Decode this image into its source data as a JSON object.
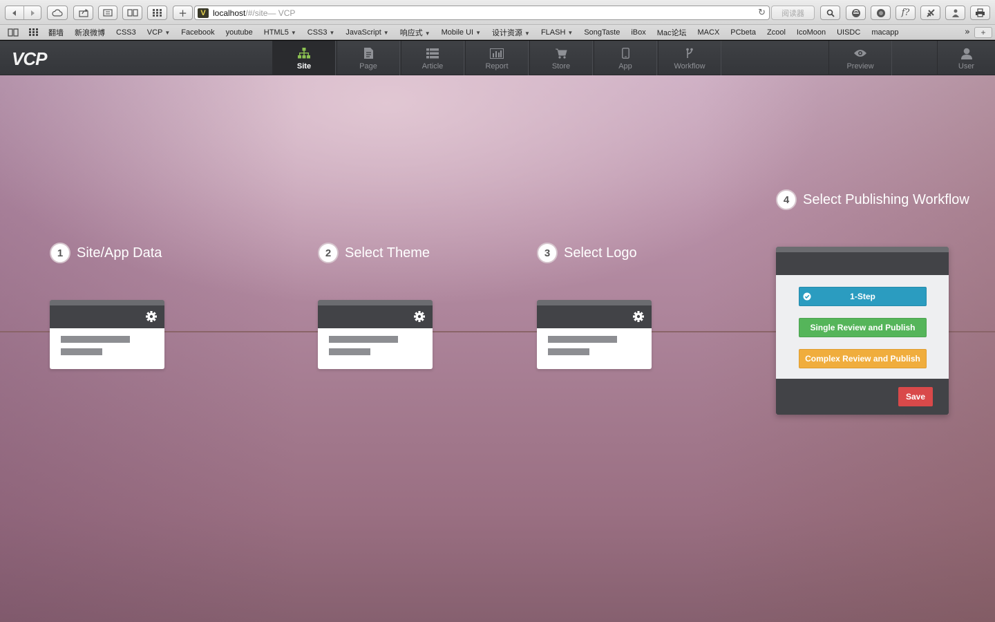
{
  "browser": {
    "url_host": "localhost",
    "url_path": "/#/site",
    "url_title": " — VCP",
    "favicon": "V",
    "reader_label": "阅读器",
    "bookmarks": [
      {
        "label": "翻墙",
        "caret": ""
      },
      {
        "label": "新浪微博",
        "caret": ""
      },
      {
        "label": "CSS3",
        "caret": ""
      },
      {
        "label": "VCP",
        "caret": "▼"
      },
      {
        "label": "Facebook",
        "caret": ""
      },
      {
        "label": "youtube",
        "caret": ""
      },
      {
        "label": "HTML5",
        "caret": "▼"
      },
      {
        "label": "CSS3",
        "caret": "▼"
      },
      {
        "label": "JavaScript",
        "caret": "▼"
      },
      {
        "label": "响应式",
        "caret": "▼"
      },
      {
        "label": "Mobile UI",
        "caret": "▼"
      },
      {
        "label": "设计资源",
        "caret": "▼"
      },
      {
        "label": "FLASH",
        "caret": "▼"
      },
      {
        "label": "SongTaste",
        "caret": ""
      },
      {
        "label": "iBox",
        "caret": ""
      },
      {
        "label": "Mac论坛",
        "caret": ""
      },
      {
        "label": "MACX",
        "caret": ""
      },
      {
        "label": "PCbeta",
        "caret": ""
      },
      {
        "label": "Zcool",
        "caret": ""
      },
      {
        "label": "IcoMoon",
        "caret": ""
      },
      {
        "label": "UISDC",
        "caret": ""
      },
      {
        "label": "macapp",
        "caret": ""
      }
    ]
  },
  "app": {
    "logo": "VCP",
    "nav": {
      "site": "Site",
      "page": "Page",
      "article": "Article",
      "report": "Report",
      "store": "Store",
      "app": "App",
      "workflow": "Workflow",
      "preview": "Preview",
      "user": "User"
    },
    "active_nav": "Site",
    "active_color": "#8cc152"
  },
  "steps": [
    {
      "num": "1",
      "title": "Site/App Data"
    },
    {
      "num": "2",
      "title": "Select Theme"
    },
    {
      "num": "3",
      "title": "Select Logo"
    },
    {
      "num": "4",
      "title": "Select Publishing Workflow"
    }
  ],
  "workflow": {
    "options": [
      {
        "label": "1-Step",
        "selected": true,
        "color": "#2b9cc0"
      },
      {
        "label": "Single Review and Publish",
        "selected": false,
        "color": "#55b55a"
      },
      {
        "label": "Complex Review and Publish",
        "selected": false,
        "color": "#f0ad3d"
      }
    ],
    "save_label": "Save",
    "save_color": "#d9494a"
  }
}
